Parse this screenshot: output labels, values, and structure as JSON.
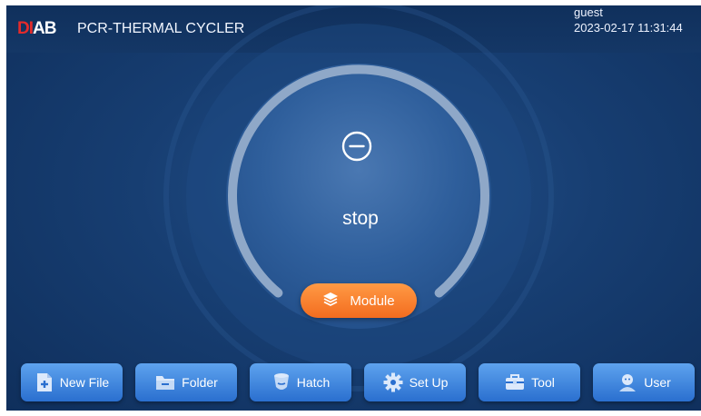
{
  "header": {
    "logo_left": "DI",
    "logo_right": "AB",
    "title": "PCR-THERMAL CYCLER",
    "user": "guest",
    "datetime": "2023-02-17 11:31:44"
  },
  "dial": {
    "status": "stop",
    "status_icon": "minus-circle-icon"
  },
  "module_button": {
    "label": "Module",
    "icon": "layers-icon"
  },
  "nav": [
    {
      "label": "New File",
      "icon": "new-file-icon"
    },
    {
      "label": "Folder",
      "icon": "folder-icon"
    },
    {
      "label": "Hatch",
      "icon": "hatch-icon"
    },
    {
      "label": "Set Up",
      "icon": "gear-icon"
    },
    {
      "label": "Tool",
      "icon": "toolbox-icon"
    },
    {
      "label": "User",
      "icon": "user-icon"
    }
  ],
  "colors": {
    "background": "#173e72",
    "accent_orange": "#f36c1f",
    "button_blue": "#2a6fcf",
    "logo_red": "#e32b2b"
  }
}
